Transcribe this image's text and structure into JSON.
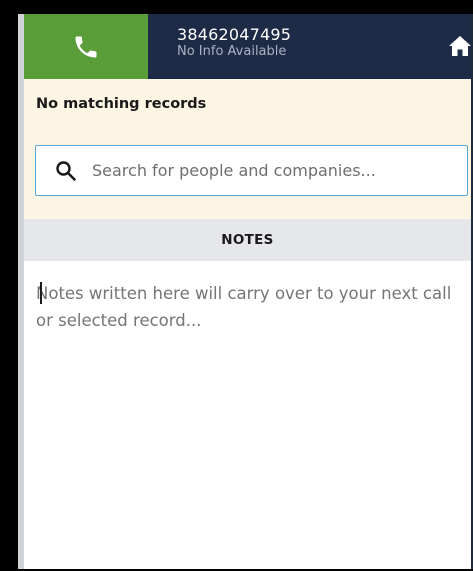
{
  "header": {
    "caller_number": "38462047495",
    "caller_info": "No Info Available",
    "call_icon": "phone-icon",
    "home_icon": "home-icon"
  },
  "notice": {
    "text": "No matching records"
  },
  "search": {
    "icon": "search-icon",
    "placeholder": "Search for people and companies...",
    "value": ""
  },
  "notes": {
    "title": "NOTES",
    "placeholder": "Notes written here will carry over to your next call or selected record...",
    "value": ""
  },
  "colors": {
    "header_bg": "#1e2b47",
    "call_button_bg": "#5a9e3a",
    "notice_bg": "#fcf5e3",
    "search_border": "#5aa7d6",
    "notes_header_bg": "#e6e7eb"
  }
}
